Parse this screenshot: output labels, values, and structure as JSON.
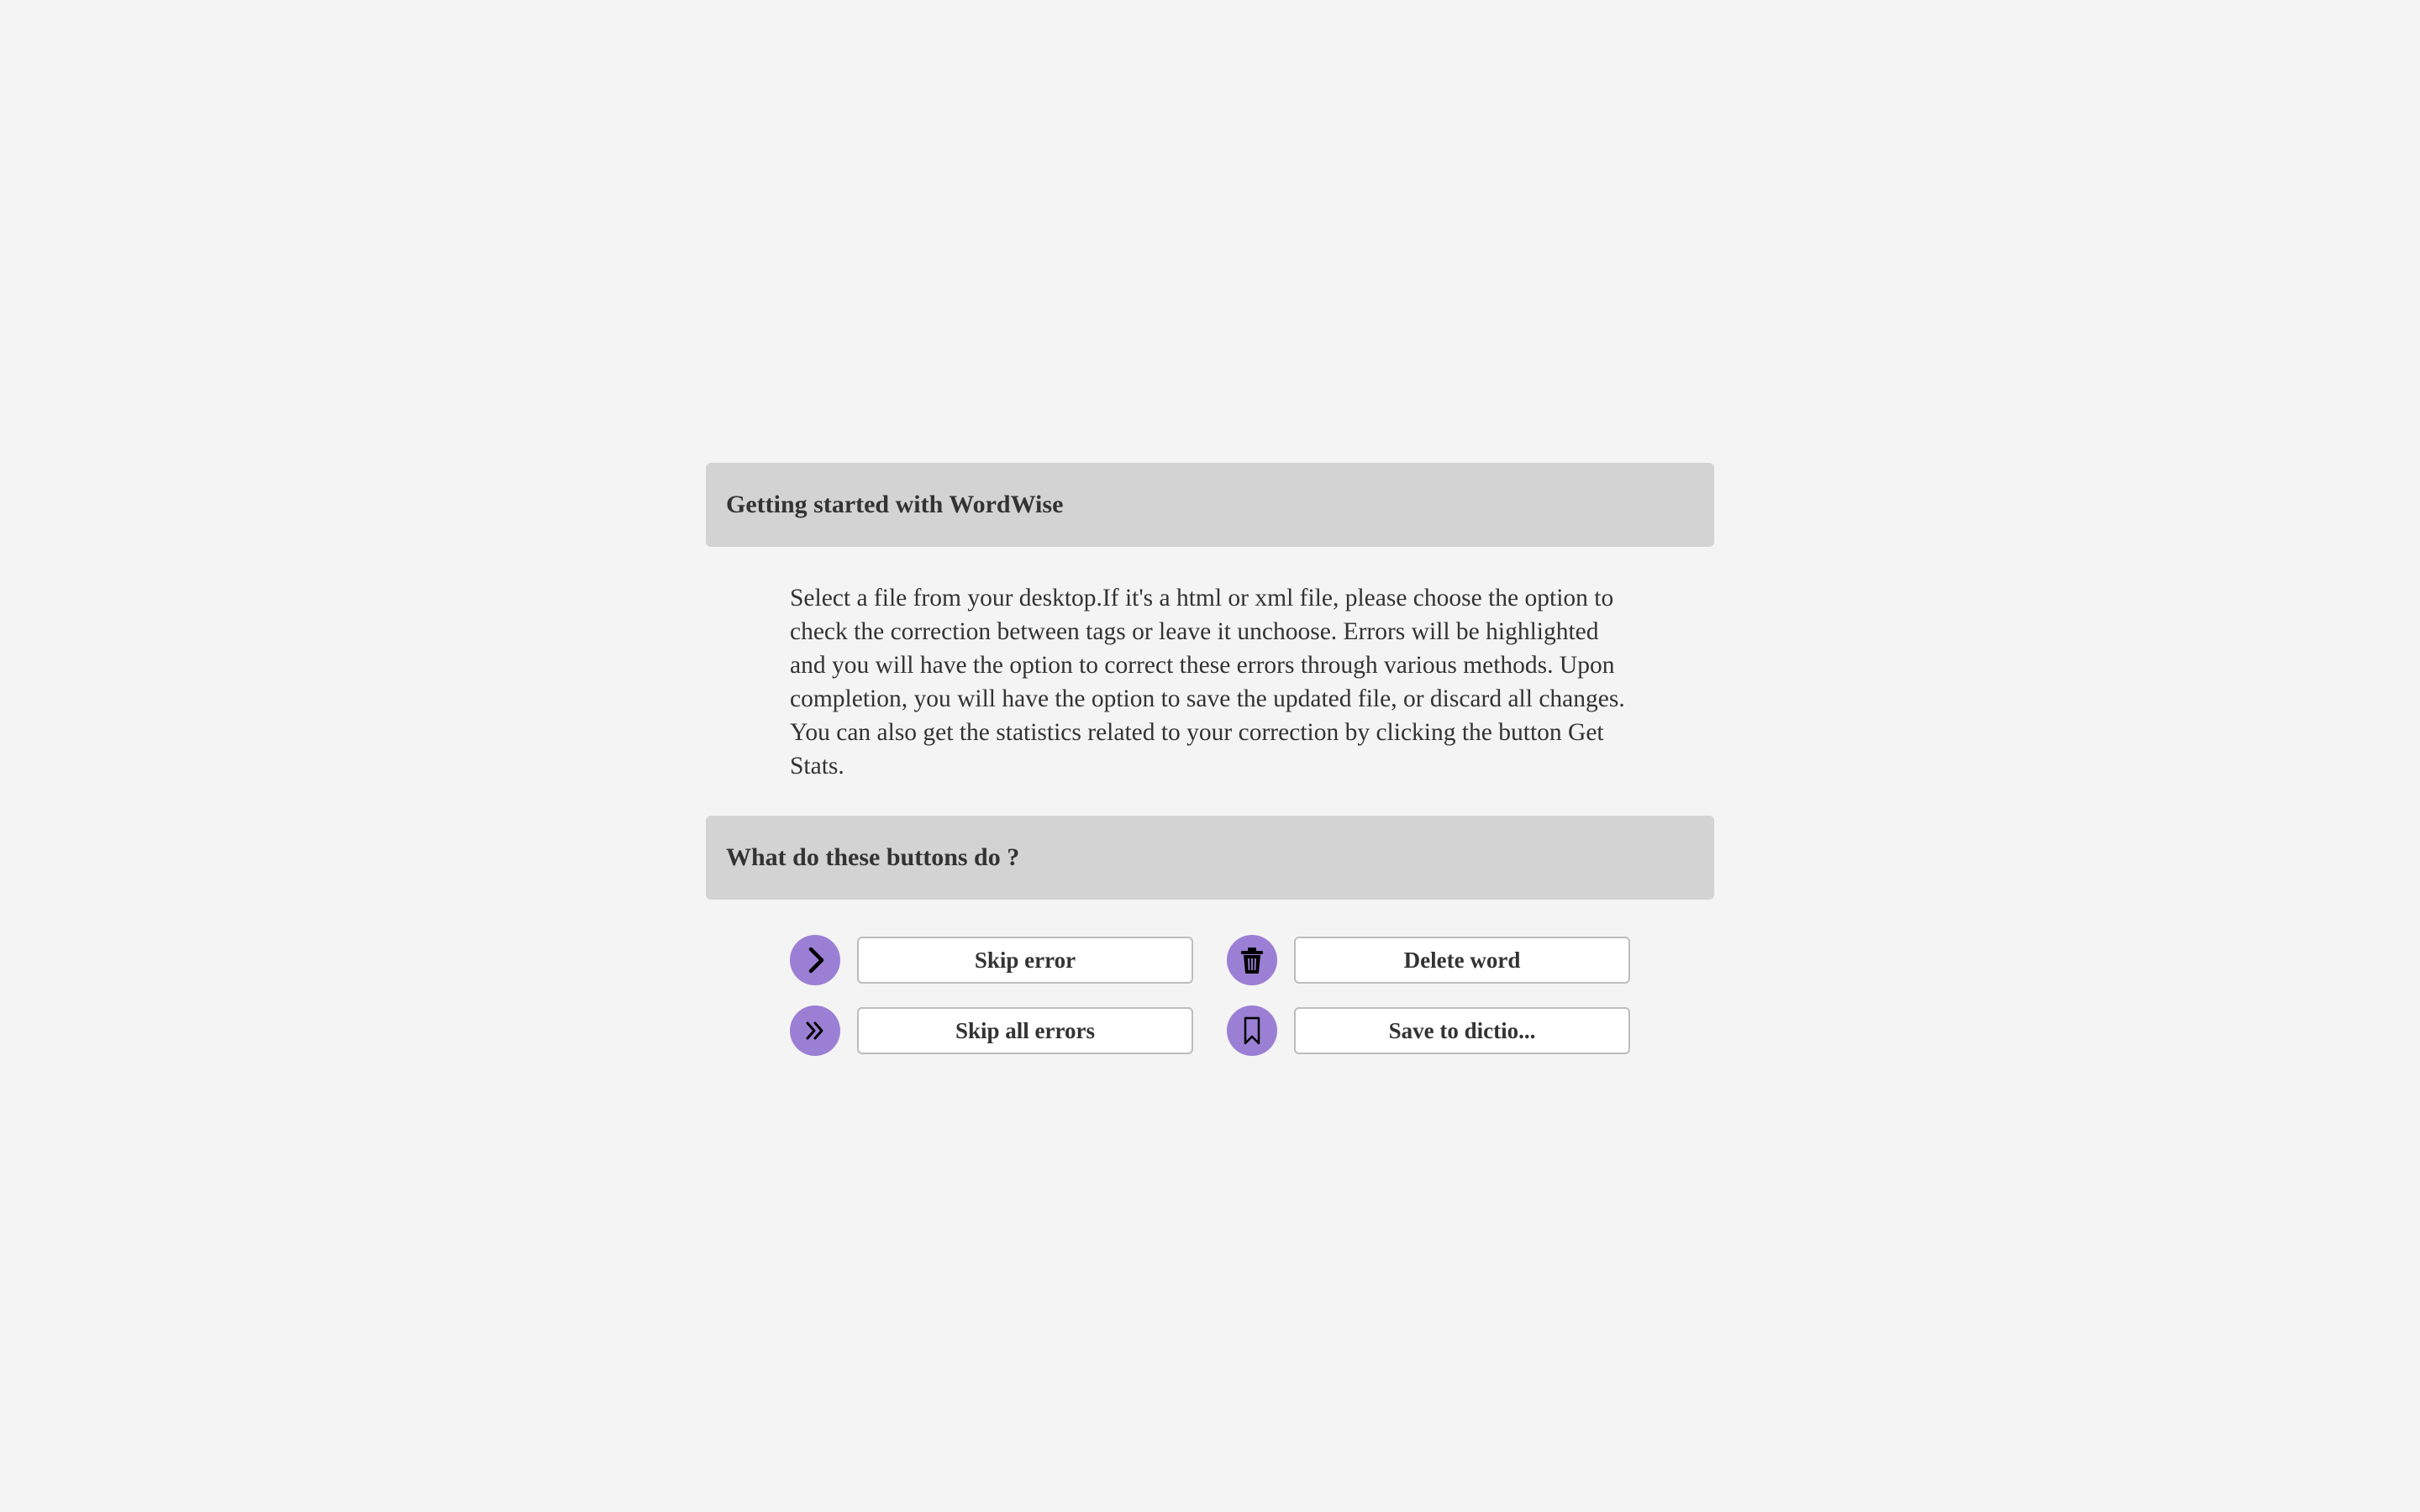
{
  "sections": {
    "getting_started": {
      "title": "Getting started with WordWise",
      "body": "Select a file from your desktop.If it's a html or xml file, please choose the option to check the correction between tags or leave it unchoose. Errors will be highlighted and you will have the option to correct these errors through various methods. Upon completion, you will have the option to save the updated file, or discard all changes. You can also get the statistics related to your correction by clicking the button Get Stats."
    },
    "buttons_help": {
      "title": "What do these buttons do ?"
    }
  },
  "buttons": {
    "skip_error": {
      "label": "Skip error",
      "icon": "chevron-right-icon"
    },
    "skip_all_errors": {
      "label": "Skip all errors",
      "icon": "double-chevron-right-icon"
    },
    "delete_word": {
      "label": "Delete word",
      "icon": "trash-icon"
    },
    "save_to_dictionary": {
      "label": "Save to dictio...",
      "icon": "bookmark-icon"
    }
  },
  "colors": {
    "accent": "#9b7fd4",
    "header_bg": "#d3d3d3",
    "page_bg": "#f4f4f4",
    "text": "#333333"
  }
}
